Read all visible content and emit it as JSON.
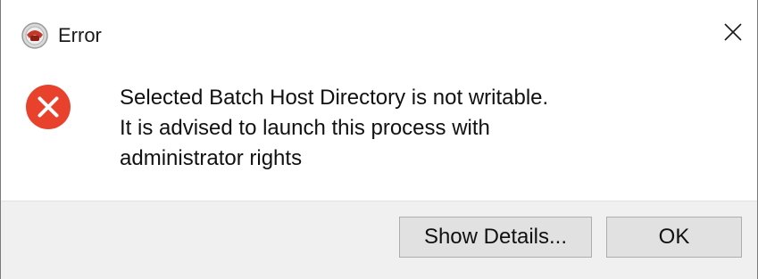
{
  "window": {
    "title": "Error",
    "app_icon": "app-logo-icon",
    "close_icon": "close-icon"
  },
  "message": {
    "icon": "error-icon",
    "lines": [
      "Selected Batch Host Directory is not writable.",
      "It is advised to launch this process with",
      "administrator rights"
    ]
  },
  "buttons": {
    "details_label": "Show Details...",
    "ok_label": "OK"
  },
  "colors": {
    "error_red": "#e8412c",
    "footer_bg": "#f0f0f0",
    "button_bg": "#e1e1e1",
    "button_border": "#adadad"
  }
}
